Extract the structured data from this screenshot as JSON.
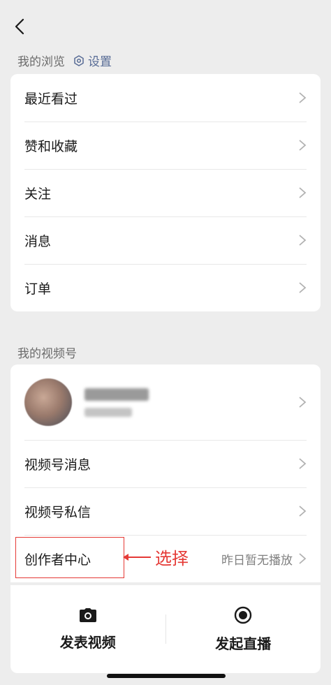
{
  "header": {
    "back_icon": "chevron-left-icon"
  },
  "browse_section": {
    "title": "我的浏览",
    "settings_label": "设置",
    "items": [
      {
        "label": "最近看过"
      },
      {
        "label": "赞和收藏"
      },
      {
        "label": "关注"
      },
      {
        "label": "消息"
      },
      {
        "label": "订单"
      }
    ]
  },
  "channels_section": {
    "title": "我的视频号",
    "items": [
      {
        "label": "视频号消息"
      },
      {
        "label": "视频号私信"
      },
      {
        "label": "创作者中心",
        "hint": "昨日暂无播放"
      }
    ]
  },
  "annotation": {
    "text": "选择",
    "color": "#e53935"
  },
  "actions": [
    {
      "label": "发表视频",
      "icon": "camera-icon"
    },
    {
      "label": "发起直播",
      "icon": "live-record-icon"
    }
  ],
  "colors": {
    "background": "#ededed",
    "link": "#576b95",
    "annotation": "#e53935"
  }
}
